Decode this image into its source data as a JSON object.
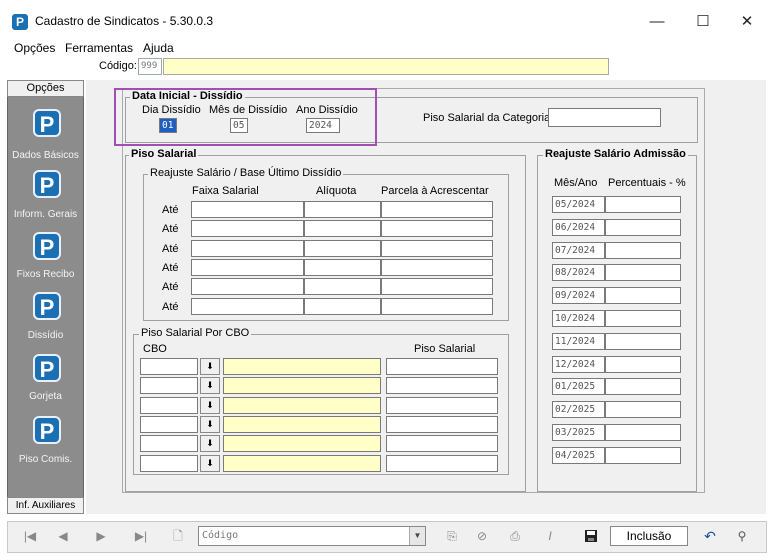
{
  "window": {
    "title": "Cadastro de Sindicatos - 5.30.0.3",
    "app_icon": "P",
    "minimize": "—",
    "maximize": "☐",
    "close": "✕"
  },
  "menu": [
    "Opções",
    "Ferramentas",
    "Ajuda"
  ],
  "codigo": {
    "label": "Código:",
    "value": "999"
  },
  "sidebar": {
    "header": "Opções",
    "items": [
      {
        "label": "Dados Básicos",
        "icon": "P"
      },
      {
        "label": "Inform. Gerais",
        "icon": "P"
      },
      {
        "label": "Fixos Recibo",
        "icon": "P"
      },
      {
        "label": "Dissídio",
        "icon": "P"
      },
      {
        "label": "Gorjeta",
        "icon": "P"
      },
      {
        "label": "Piso Comis.",
        "icon": "P"
      }
    ],
    "footer": "Inf. Auxiliares"
  },
  "data_inicial": {
    "title": "Data Inicial - Dissídio",
    "dia_label": "Dia Dissídio",
    "mes_label": "Mês de Dissídio",
    "ano_label": "Ano Dissídio",
    "dia": "01",
    "mes": "05",
    "ano": "2024"
  },
  "piso_categoria": {
    "label": "Piso Salarial da Categoria:",
    "value": ""
  },
  "piso_salarial": {
    "title": "Piso Salarial",
    "reajuste_title": "Reajuste Salário / Base Último Dissídio",
    "col_faixa": "Faixa Salarial",
    "col_aliquota": "Alíquota",
    "col_parcela": "Parcela à Acrescentar",
    "row_label": "Até",
    "rows": 6
  },
  "piso_cbo": {
    "title": "Piso Salarial Por CBO",
    "col_cbo": "CBO",
    "col_piso": "Piso Salarial",
    "download_glyph": "⬇",
    "rows": 6
  },
  "reajuste_admissao": {
    "title": "Reajuste Salário Admissão",
    "col_mes": "Mês/Ano",
    "col_perc": "Percentuais - %",
    "months": [
      "05/2024",
      "06/2024",
      "07/2024",
      "08/2024",
      "09/2024",
      "10/2024",
      "11/2024",
      "12/2024",
      "01/2025",
      "02/2025",
      "03/2025",
      "04/2025"
    ]
  },
  "toolbar": {
    "first": "|◀",
    "prev": "◀",
    "next": "▶",
    "last": "▶|",
    "new": "🗋",
    "combo_value": "Código",
    "combo_arrow": "▼",
    "mode": "Inclusão",
    "undo": "↶",
    "find": "🔍"
  },
  "colors": {
    "highlight": "#a24fb3",
    "sidebar_bg": "#8c8c8c",
    "icon_blue": "#1b6fb3",
    "yellow_field": "#ffffc8"
  }
}
